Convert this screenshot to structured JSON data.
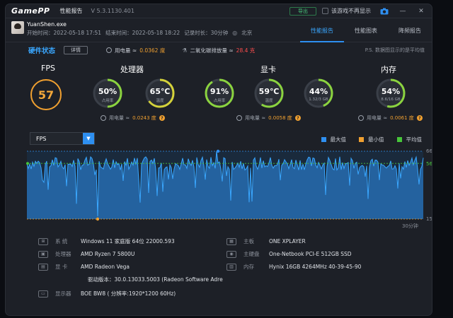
{
  "titlebar": {
    "logo": "GamePP",
    "report_title": "性能报告",
    "version": "V 5.3.1130.401",
    "export_label": "导出",
    "no_display_label": "该游戏不再显示"
  },
  "header": {
    "process_name": "YuanShen.exe",
    "start_time": "开始时间：2022-05-18 17:51",
    "end_time": "结束时间：2022-05-18 18:22",
    "record_duration": "记录时长：30分钟",
    "location": "北京",
    "tabs": [
      {
        "label": "性能报告",
        "active": true
      },
      {
        "label": "性能图表",
        "active": false
      },
      {
        "label": "降频报告",
        "active": false
      }
    ]
  },
  "hw": {
    "title": "硬件状态",
    "detail_label": "详情",
    "power_label": "用电量 ≈",
    "power_value": "0.0362 度",
    "co2_label": "二氧化碳排放量 ≈",
    "co2_value": "28.4 克",
    "note": "P.S. 数据图显示的是平均值"
  },
  "fps": {
    "title": "FPS",
    "value": "57",
    "color": "#f0a030"
  },
  "cpu": {
    "title": "处理器",
    "usage_value": "50%",
    "usage_label": "占用率",
    "usage_fraction": 0.5,
    "temp_value": "65℃",
    "temp_label": "温度",
    "temp_fraction": 0.65,
    "power_label": "用电量 ≈",
    "power_value": "0.0243 度"
  },
  "gpu": {
    "title": "显卡",
    "usage_value": "91%",
    "usage_label": "占用率",
    "usage_fraction": 0.91,
    "temp_value": "59℃",
    "temp_label": "温度",
    "temp_fraction": 0.59,
    "mem_value": "44%",
    "mem_label": "1.32/3 GB",
    "mem_fraction": 0.44,
    "power_label": "用电量 ≈",
    "power_value": "0.0058 度"
  },
  "memory": {
    "title": "内存",
    "usage_value": "54%",
    "usage_label": "8.6/16 GB",
    "usage_fraction": 0.54,
    "power_label": "用电量 ≈",
    "power_value": "0.0061 度"
  },
  "colors": {
    "accent": "#2e8ff0",
    "gauge_track": "#3a3f48",
    "gauge_green": "#8bd33f",
    "gauge_yellow": "#d4d23a",
    "fps_orange": "#f0a030"
  },
  "selector": {
    "value": "FPS"
  },
  "legend": [
    {
      "label": "最大值",
      "color": "#2e8ff0"
    },
    {
      "label": "最小值",
      "color": "#f0a030"
    },
    {
      "label": "平均值",
      "color": "#47c53a"
    }
  ],
  "chart_data": {
    "type": "area",
    "series_color": "#2e8ff0",
    "y_max_label": "66",
    "y_avg_label": "56.86",
    "y_min_label": "15",
    "x_label": "30分钟",
    "ylim": [
      15,
      66
    ],
    "avg": 56.86,
    "max": 66,
    "min": 15
  },
  "info": {
    "system_label": "系    统",
    "system_value": "Windows 11 家庭版 64位   22000.593",
    "cpu_label": "处理器",
    "cpu_value": "AMD Ryzen 7 5800U",
    "gpu_label": "显    卡",
    "gpu_value": "AMD Radeon Vega",
    "driver_value": "驱动版本：30.0.13033.5003 (Radeon Software Adre",
    "display_label": "显示器",
    "display_value": "BOE BW8 ( 分辨率:1920*1200 60Hz)",
    "board_label": "主板",
    "board_value": "ONE XPLAYER",
    "disk_label": "主硬盘",
    "disk_value": "One-Netbook PCI-E 512GB SSD",
    "mem_label": "内存",
    "mem_value": "Hynix 16GB 4264MHz 40-39-45-90"
  }
}
